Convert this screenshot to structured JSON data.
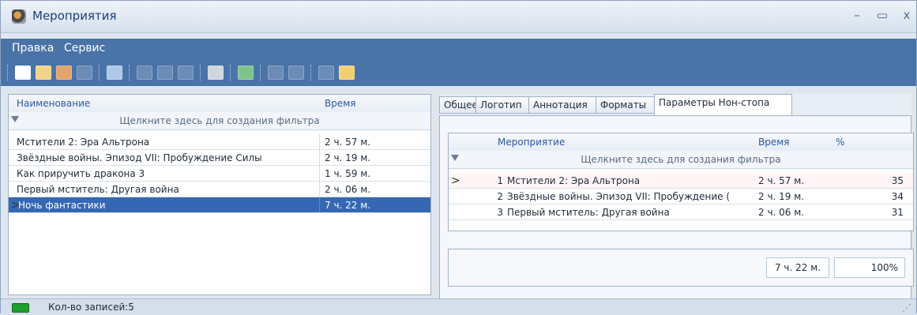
{
  "window": {
    "title": "Мероприятия",
    "minimize": "–",
    "maximize": "▭",
    "close": "x"
  },
  "menu": [
    "Правка",
    "Сервис"
  ],
  "left_grid": {
    "columns": [
      "Наименование",
      "Время"
    ],
    "filter_hint": "Щелкните здесь для создания фильтра",
    "rows": [
      {
        "name": "Мстители 2: Эра Альтрона",
        "time": "2 ч. 57 м."
      },
      {
        "name": "Звёздные войны. Эпизод VII: Пробуждение Силы",
        "time": "2 ч. 19 м."
      },
      {
        "name": "Как приручить дракона 3",
        "time": "1 ч. 59 м."
      },
      {
        "name": "Первый мститель: Другая война",
        "time": "2 ч. 06 м."
      },
      {
        "name": "Ночь фантастики",
        "time": "7 ч. 22 м.",
        "selected": true
      }
    ],
    "selection_marker": ">"
  },
  "tabs": [
    "Общее",
    "Логотип",
    "Аннотация",
    "Форматы",
    "Параметры Нон-стопа"
  ],
  "active_tab": "Параметры Нон-стопа",
  "nonstop_grid": {
    "columns": [
      "Мероприятие",
      "Время",
      "%"
    ],
    "filter_hint": "Щелкните здесь для создания фильтра",
    "rows": [
      {
        "num": "1",
        "name": "Мстители 2: Эра Альтрона",
        "time": "2 ч. 57 м.",
        "pct": "35"
      },
      {
        "num": "2",
        "name": "Звёздные войны. Эпизод VII: Пробуждение (",
        "time": "2 ч. 19 м.",
        "pct": "34"
      },
      {
        "num": "3",
        "name": "Первый мститель: Другая война",
        "time": "2 ч. 06 м.",
        "pct": "31"
      }
    ],
    "selection_marker": ">",
    "total_time": "7 ч. 22 м.",
    "total_pct": "100%"
  },
  "status": {
    "records_label": "Кол-во записей:5"
  },
  "colors": {
    "menubar": "#4a73a8",
    "selection": "#3567b5",
    "header_text": "#2a57a8"
  },
  "toolbar_icons": [
    "new-icon",
    "edit-icon",
    "delete-icon",
    "disabled-icon",
    "refresh-icon",
    "copy-icon",
    "edit2-icon",
    "export-icon",
    "print-icon",
    "excel-icon",
    "grid-icon",
    "settings-icon",
    "trash-icon",
    "folder-icon"
  ]
}
